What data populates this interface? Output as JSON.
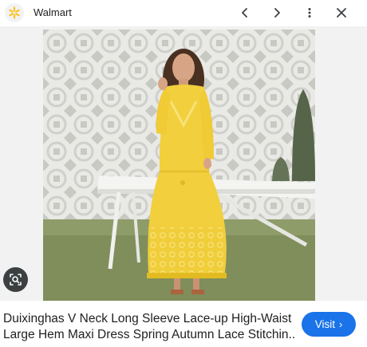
{
  "header": {
    "site_name": "Walmart",
    "favicon": "walmart-spark-icon",
    "brand_color": "#ffc220",
    "icons": [
      "chevron-left-icon",
      "chevron-right-icon",
      "more-vert-icon",
      "close-icon"
    ]
  },
  "image": {
    "lens_icon": "image-search-icon",
    "dress_color": "#f2cf3c"
  },
  "result": {
    "title_line1": "Duixinghas V Neck Long Sleeve Lace-up High-Waist",
    "title_line2": "Large Hem Maxi Dress Spring Autumn Lace Stitchin...",
    "visit_label": "Visit",
    "visit_icon": "chevron-right-icon",
    "accent": "#1a73e8"
  }
}
